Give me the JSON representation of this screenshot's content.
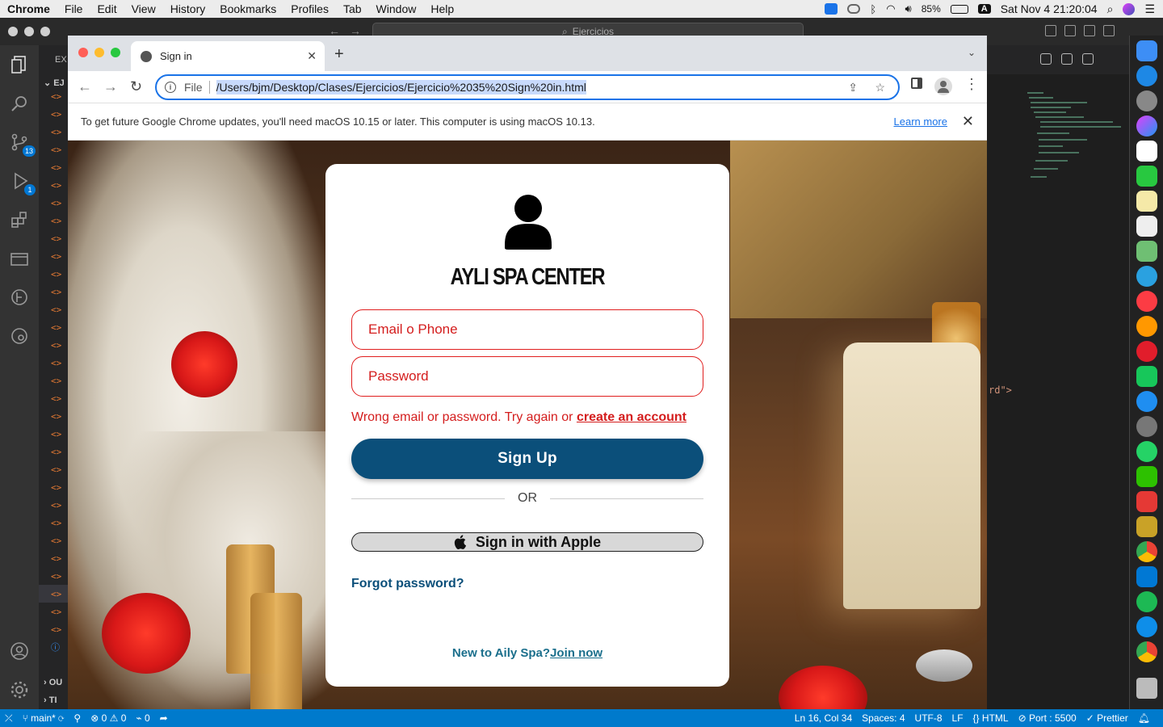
{
  "menubar": {
    "app_name": "Chrome",
    "items": [
      "File",
      "Edit",
      "View",
      "History",
      "Bookmarks",
      "Profiles",
      "Tab",
      "Window",
      "Help"
    ],
    "battery": "85%",
    "input_source": "A",
    "datetime": "Sat Nov 4  21:20:04"
  },
  "vscode": {
    "search_text": "Ejercicios",
    "explorer_title": "EX",
    "folder_label": "EJ",
    "outline_label": "OU",
    "timeline_label": "TI",
    "scm_badge": "13",
    "debug_badge": "1",
    "code_fragment": "rd\">",
    "status": {
      "branch": "main*",
      "errors": "0",
      "warnings": "0",
      "ports": "0",
      "position": "Ln 16, Col 34",
      "spaces": "Spaces: 4",
      "encoding": "UTF-8",
      "eol": "LF",
      "language": "HTML",
      "port": "Port : 5500",
      "formatter": "Prettier"
    }
  },
  "chrome": {
    "tab_title": "Sign in",
    "omnibox_scheme": "File",
    "url": "/Users/bjm/Desktop/Clases/Ejercicios/Ejercicio%2035%20Sign%20in.html",
    "infobar_text": "To get future Google Chrome updates, you'll need macOS 10.15 or later. This computer is using macOS 10.13.",
    "infobar_link": "Learn more"
  },
  "signin": {
    "brand": "AYLI SPA CENTER",
    "email_placeholder": "Email o Phone",
    "password_placeholder": "Password",
    "error_text": "Wrong email or password. Try again or ",
    "error_link": "create an account",
    "signup_label": "Sign Up",
    "or_label": "OR",
    "apple_label": "Sign in with Apple",
    "forgot_label": "Forgot password?",
    "newto_text": "New to Aily Spa?",
    "join_label": "Join now"
  },
  "colors": {
    "primary_button": "#0b4f7a",
    "error_red": "#d41d1d",
    "link_blue": "#1a73e8",
    "vscode_status": "#007acc"
  }
}
